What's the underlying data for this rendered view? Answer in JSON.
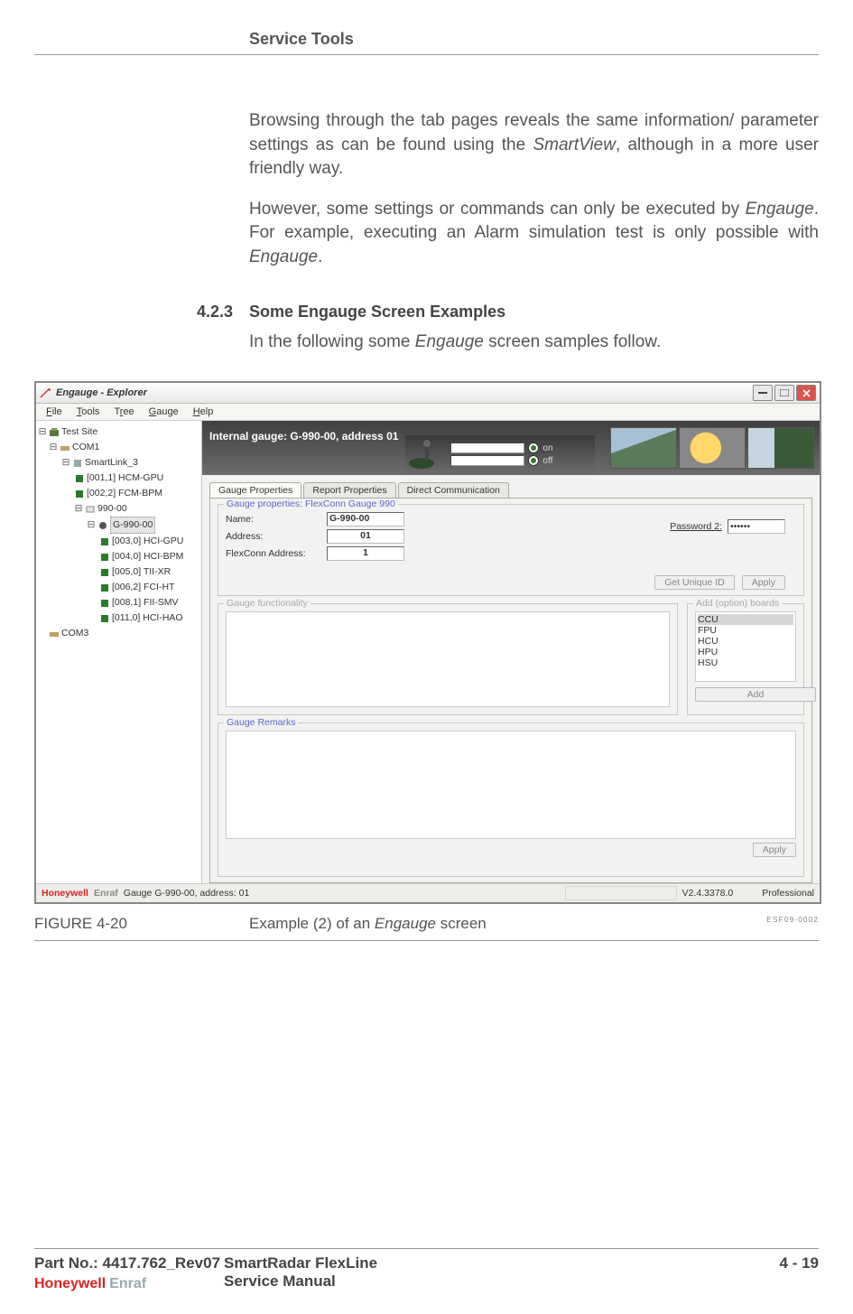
{
  "header": {
    "section_title": "Service Tools"
  },
  "body": {
    "p1_a": "Browsing through the tab pages reveals the same information/ parameter settings as can be found using the ",
    "p1_b_em": "SmartView",
    "p1_c": ", although in a more user friendly way.",
    "p2_a": "However, some settings or commands can only be executed by ",
    "p2_b_em": "Engauge",
    "p2_c": ". For example, executing an Alarm simulation test is only possible with ",
    "p2_d_em": "Engauge",
    "p2_e": ".",
    "sub_num": "4.2.3",
    "sub_title": "Some Engauge Screen Examples",
    "p3_a": "In the following some ",
    "p3_b_em": "Engauge",
    "p3_c": " screen samples follow."
  },
  "window": {
    "title": "Engauge - Explorer",
    "menus": [
      "File",
      "Tools",
      "Tree",
      "Gauge",
      "Help"
    ],
    "tree": {
      "root": "Test Site",
      "com1": "COM1",
      "smartlink": "SmartLink_3",
      "items_a": [
        "[001,1] HCM-GPU",
        "[002,2] FCM-BPM"
      ],
      "g990": "990-00",
      "g990_sel": "G-990-00",
      "items_b": [
        "[003,0] HCI-GPU",
        "[004,0] HCI-BPM",
        "[005,0] TII-XR",
        "[006,2] FCI-HT",
        "[008,1] FII-SMV",
        "[011,0] HCI-HAO"
      ],
      "com3": "COM3"
    },
    "gauge_header": {
      "title": "Internal gauge: G-990-00, address 01",
      "on": "on",
      "off": "off"
    },
    "tabs": [
      "Gauge Properties",
      "Report Properties",
      "Direct Communication"
    ],
    "props": {
      "legend": "Gauge properties: FlexConn Gauge 990",
      "name_label": "Name:",
      "name": "G-990-00",
      "addr_label": "Address:",
      "addr": "01",
      "flex_label": "FlexConn Address:",
      "flex": "1",
      "pwd_label": "Password 2:",
      "pwd": "••••••",
      "btn_getid": "Get Unique ID",
      "btn_apply": "Apply"
    },
    "functionality_legend": "Gauge functionality",
    "addboards": {
      "legend": "Add (option) boards",
      "options": [
        "CCU",
        "FPU",
        "HCU",
        "HPU",
        "HSU"
      ],
      "btn_add": "Add"
    },
    "remarks_legend": "Gauge Remarks",
    "remarks_apply": "Apply",
    "status": {
      "brand1": "Honeywell",
      "brand2": "Enraf",
      "msg": "Gauge G-990-00, address: 01",
      "version": "V2.4.3378.0",
      "mode": "Professional"
    }
  },
  "figure": {
    "label": "FIGURE  4-20",
    "desc_a": "Example (2) of an ",
    "desc_em": "Engauge",
    "desc_b": " screen",
    "code": "ESF09-0002"
  },
  "footer": {
    "part": "Part No.: 4417.762_Rev07",
    "line1": "SmartRadar FlexLine",
    "line2": "Service Manual",
    "page": "4 - 19",
    "brand1": "Honeywell",
    "brand2": "Enraf"
  }
}
